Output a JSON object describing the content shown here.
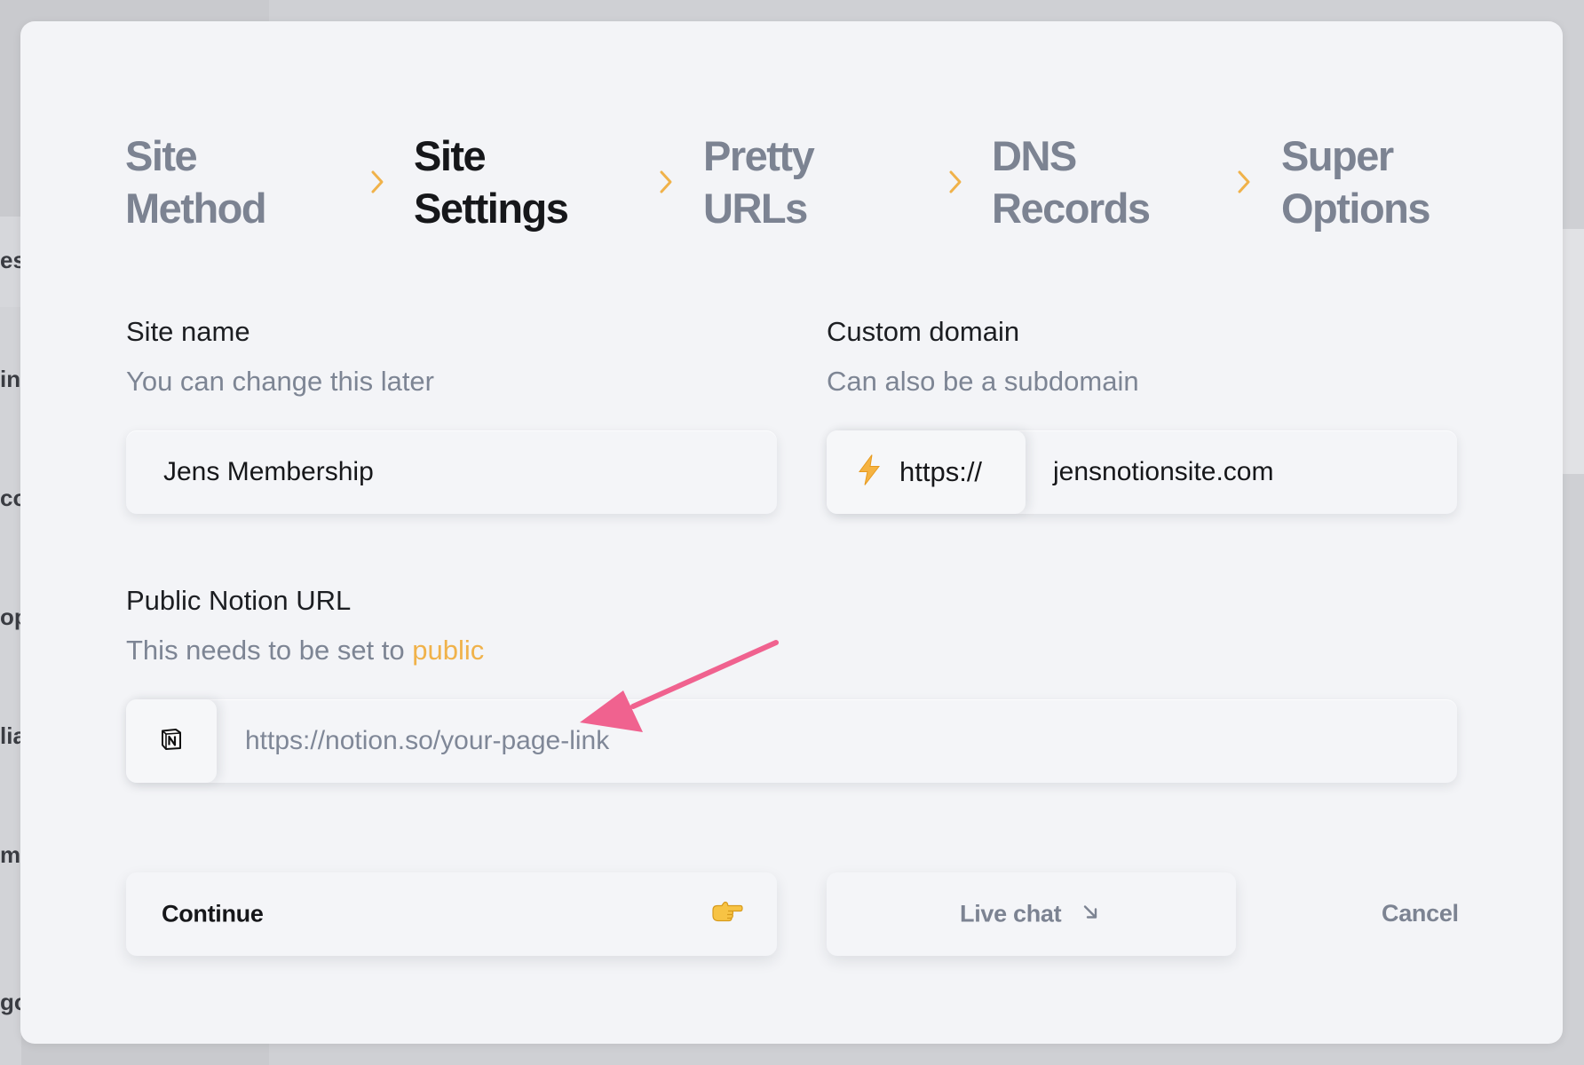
{
  "backdrop": {
    "fragments": [
      "es",
      "in",
      "co",
      "op",
      "lia",
      "mi",
      "go"
    ]
  },
  "stepper": {
    "steps": [
      {
        "line1": "Site",
        "line2": "Method",
        "active": false
      },
      {
        "line1": "Site",
        "line2": "Settings",
        "active": true
      },
      {
        "line1": "Pretty",
        "line2": "URLs",
        "active": false
      },
      {
        "line1": "DNS",
        "line2": "Records",
        "active": false
      },
      {
        "line1": "Super",
        "line2": "Options",
        "active": false
      }
    ],
    "separator_icon": "chevron-right-icon"
  },
  "site_name": {
    "label": "Site name",
    "help": "You can change this later",
    "value": "Jens Membership"
  },
  "custom_domain": {
    "label": "Custom domain",
    "help": "Can also be a subdomain",
    "prefix_icon": "lightning-bolt-icon",
    "prefix": "https://",
    "value": "jensnotionsite.com"
  },
  "notion_url": {
    "label": "Public Notion URL",
    "help_prefix": "This needs to be set to ",
    "help_accent": "public",
    "prefix_icon": "notion-logo-icon",
    "placeholder": "https://notion.so/your-page-link"
  },
  "actions": {
    "continue_label": "Continue",
    "continue_icon": "pointing-hand-icon",
    "live_chat_label": "Live chat",
    "live_chat_icon": "arrow-down-right-icon",
    "cancel_label": "Cancel"
  },
  "colors": {
    "accent": "#f0b24a",
    "annotation_arrow": "#f0628f",
    "muted_text": "#7c8392",
    "text": "#16171a",
    "modal_bg": "#f3f4f7"
  }
}
